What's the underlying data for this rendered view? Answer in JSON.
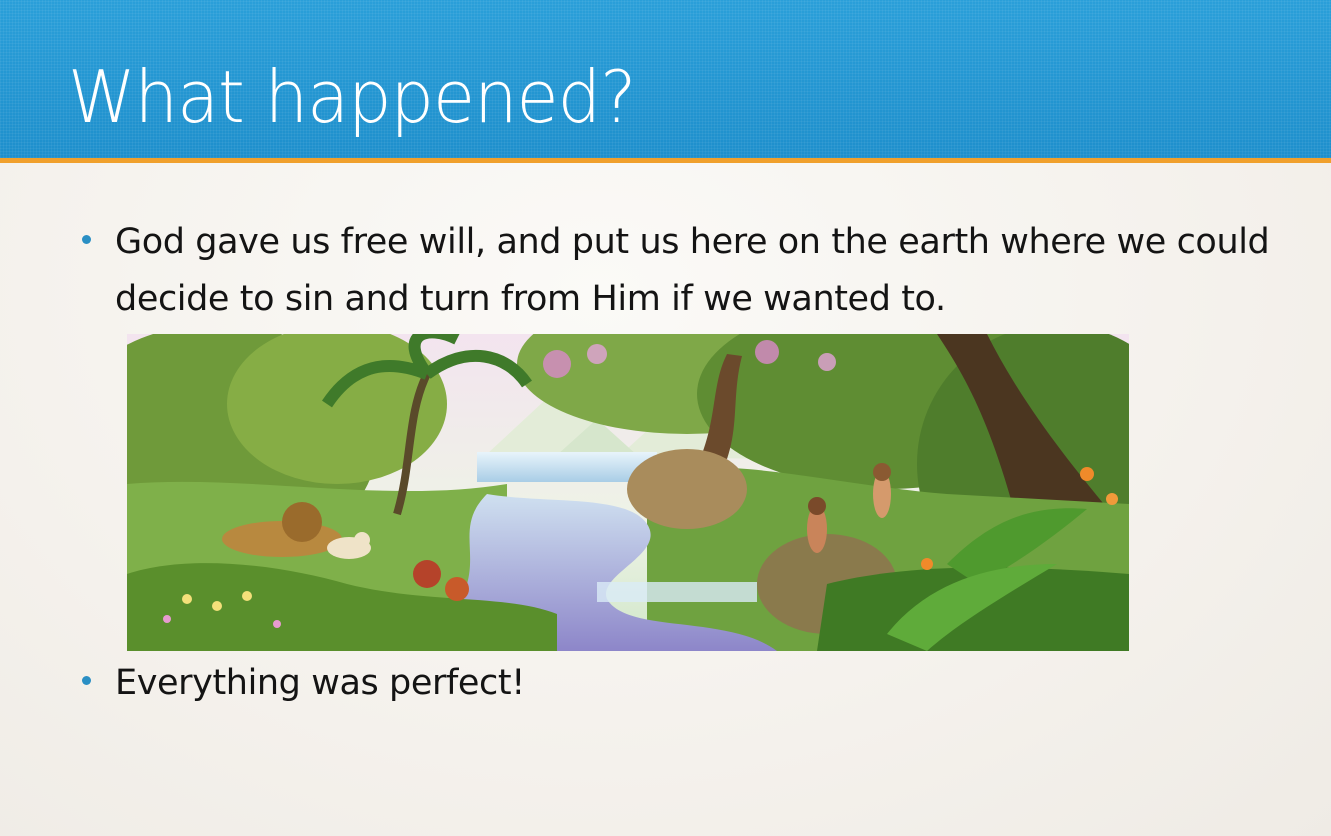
{
  "slide": {
    "title": "What happened?",
    "bullets": [
      "God gave us free will, and put us here on the earth where we could decide to sin and turn from Him if we wanted to.",
      "Everything was perfect!"
    ]
  },
  "illustration": {
    "description_icon": "garden-of-eden-illustration"
  },
  "colors": {
    "header": "#1e8fcc",
    "accent": "#f0a02c",
    "bullet": "#2a8fc4",
    "background": "#f4f1ec"
  }
}
